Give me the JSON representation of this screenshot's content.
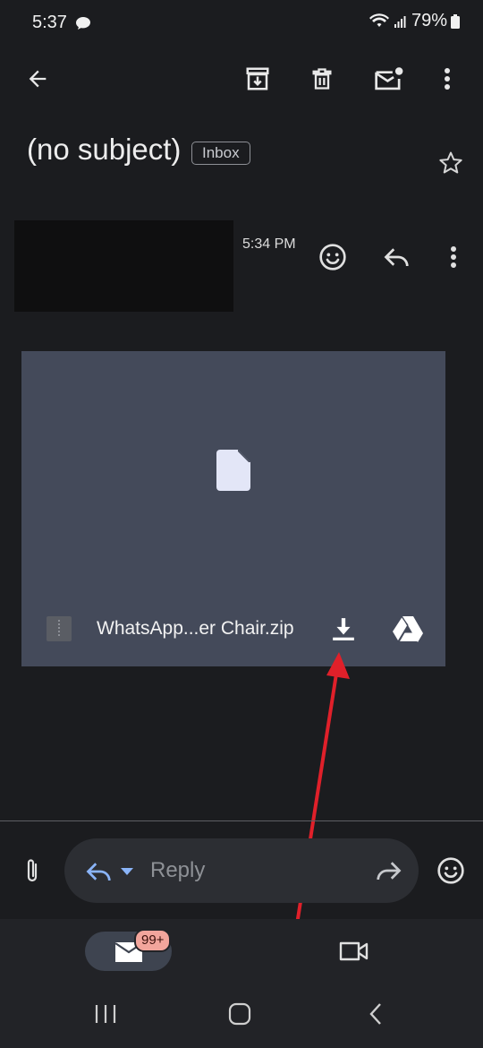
{
  "status_bar": {
    "time": "5:37",
    "battery": "79%"
  },
  "email": {
    "subject": "(no subject)",
    "label": "Inbox",
    "time": "5:34 PM"
  },
  "attachment": {
    "filename": "WhatsApp...er Chair.zip"
  },
  "reply_bar": {
    "placeholder": "Reply"
  },
  "bottom_nav": {
    "mail_badge": "99+"
  },
  "colors": {
    "accent": "#8ab4f8",
    "annotation_arrow": "#e0202a"
  },
  "icons": [
    "back-arrow-icon",
    "archive-icon",
    "delete-icon",
    "mark-unread-icon",
    "more-vert-icon",
    "star-icon",
    "emoji-icon",
    "reply-icon",
    "file-icon",
    "download-icon",
    "drive-icon",
    "attach-icon",
    "forward-icon",
    "mail-icon",
    "video-icon"
  ]
}
